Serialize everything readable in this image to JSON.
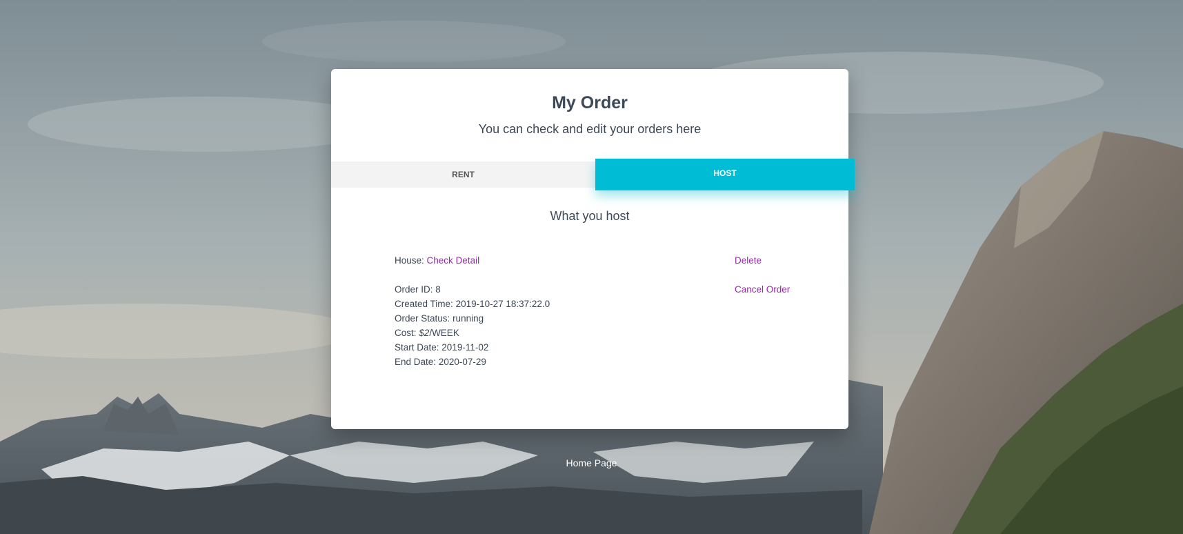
{
  "card": {
    "title": "My Order",
    "subtitle": "You can check and edit your orders here"
  },
  "tabs": {
    "rent_label": "RENT",
    "host_label": "HOST",
    "active": "HOST"
  },
  "host_section": {
    "heading": "What you host",
    "order": {
      "house_label": "House:",
      "check_detail_link": "Check Detail",
      "delete_link": "Delete",
      "cancel_order_link": "Cancel Order",
      "order_id_label": "Order ID:",
      "order_id": "8",
      "created_time_label": "Created Time:",
      "created_time": "2019-10-27 18:37:22.0",
      "status_label": "Order Status:",
      "status": "running",
      "cost_label": "Cost:",
      "cost_amount": "$2",
      "cost_unit": "/WEEK",
      "start_date_label": "Start Date:",
      "start_date": "2019-11-02",
      "end_date_label": "End Date:",
      "end_date": "2020-07-29"
    }
  },
  "footer": {
    "home_link": "Home Page"
  },
  "colors": {
    "accent": "#00bcd4",
    "link": "#9c27b0",
    "text": "#3c4858"
  }
}
